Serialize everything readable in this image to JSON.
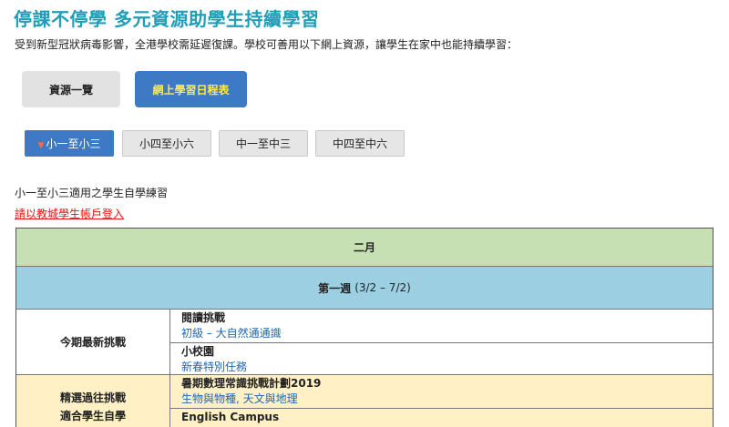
{
  "page": {
    "title": "停課不停學 多元資源助學生持續學習",
    "intro": "受到新型冠狀病毒影響，全港學校需延遲復課。學校可善用以下網上資源，讓學生在家中也能持續學習："
  },
  "main_buttons": {
    "resources": "資源一覽",
    "schedule": "網上學習日程表"
  },
  "level_tabs": [
    {
      "label": "小一至小三",
      "active": true
    },
    {
      "label": "小四至小六",
      "active": false
    },
    {
      "label": "中一至中三",
      "active": false
    },
    {
      "label": "中四至中六",
      "active": false
    }
  ],
  "subheading": "小一至小三適用之學生自學練習",
  "login_link": "請以教城學生帳戶登入",
  "schedule_table": {
    "month": "二月",
    "week_label": "第一週",
    "week_range": "(3/2 – 7/2)",
    "section1": {
      "label": "今期最新挑戰",
      "items": [
        {
          "title": "閱讀挑戰",
          "link": "初級 – 大自然通通識"
        },
        {
          "title": "小校園",
          "link": "新春特別任務"
        }
      ]
    },
    "section2": {
      "label_line1": "精選過往挑戰",
      "label_line2": "適合學生自學",
      "items": [
        {
          "title": "暑期數理常識挑戰計劃2019",
          "link": "生物與物種, 天文與地理"
        },
        {
          "title": "English Campus",
          "link": ""
        }
      ]
    }
  },
  "colors": {
    "title": "#1e9eb7",
    "primary_blue": "#3d79c4",
    "schedule_text": "#ffe94f",
    "month_row": "#c6e0b3",
    "week_row": "#9dcfe3",
    "past_section": "#fff0c6",
    "link": "#1f66b0",
    "login_link": "#ee1111"
  }
}
